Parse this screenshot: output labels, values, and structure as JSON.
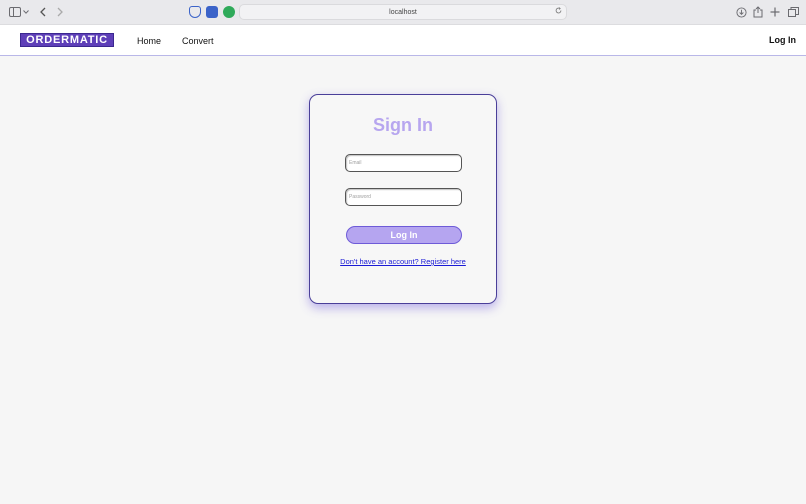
{
  "browser": {
    "url": "localhost"
  },
  "nav": {
    "logo": "ORDERMATIC",
    "links": [
      "Home",
      "Convert"
    ],
    "login": "Log In"
  },
  "card": {
    "title": "Sign In",
    "email_placeholder": "Email",
    "password_placeholder": "Password",
    "button": "Log In",
    "register_link": "Don't have an account? Register here"
  },
  "colors": {
    "brand": "#5e3fb8",
    "title": "#b7a6ef",
    "button": "#b5a5f0",
    "link": "#1a1ad6"
  }
}
